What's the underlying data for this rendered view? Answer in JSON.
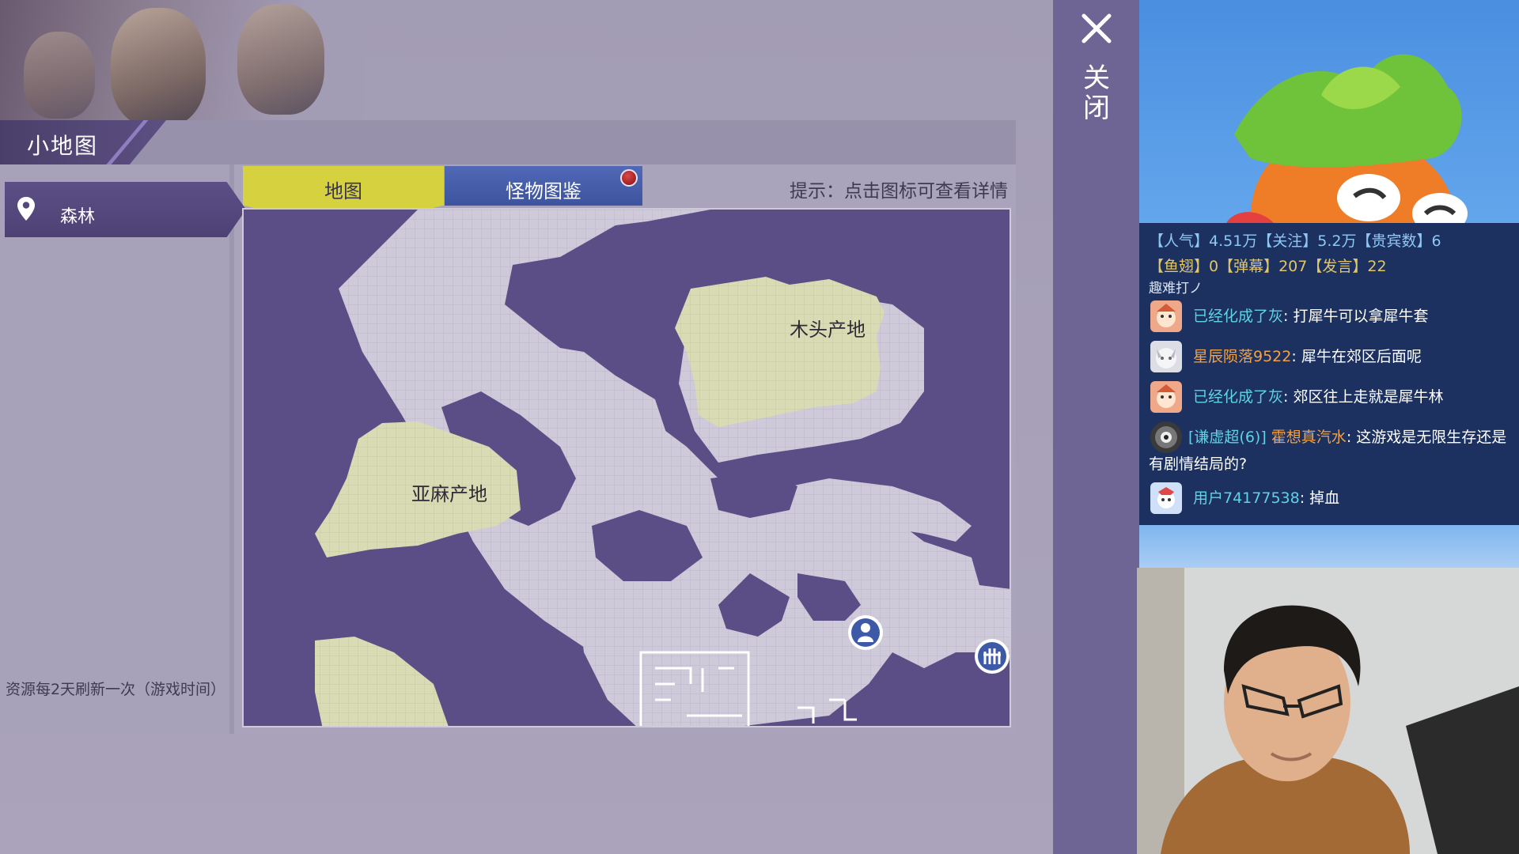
{
  "panel": {
    "title": "小地图",
    "region": "森林",
    "refresh_note": "资源每2天刷新一次（游戏时间）"
  },
  "tabs": {
    "map": "地图",
    "monster": "怪物图鉴"
  },
  "hint": "提示：点击图标可查看详情",
  "map": {
    "areas": [
      "木头产地",
      "亚麻产地"
    ],
    "colors": {
      "unexplored": "#5b4d86",
      "walkable": "#cfcad9",
      "resource": "#d8dbb3"
    }
  },
  "close": {
    "label": "关闭"
  },
  "stream": {
    "stats_line1": "【人气】4.51万【关注】5.2万【贵宾数】6",
    "stats_line2": "【鱼翅】0【弹幕】207【发言】22",
    "caption": "趣难打ノ",
    "messages": [
      {
        "user": "已经化成了灰",
        "text": "打犀牛可以拿犀牛套"
      },
      {
        "user": "星辰陨落9522",
        "text": "犀牛在郊区后面呢"
      },
      {
        "user": "已经化成了灰",
        "text": "郊区往上走就是犀牛林"
      },
      {
        "badge": "[谦虚超(6)]",
        "user": "霍想真汽水",
        "text": "这游戏是无限生存还是有剧情结局的?"
      },
      {
        "user": "用户74177538",
        "text": "掉血"
      }
    ]
  }
}
